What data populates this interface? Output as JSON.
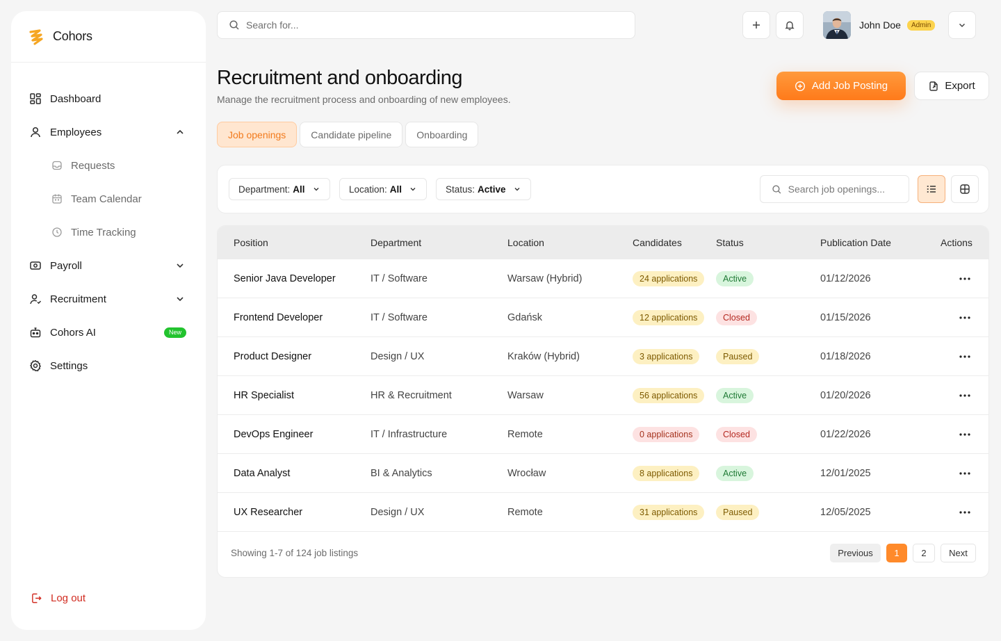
{
  "app": {
    "name": "Cohors"
  },
  "colors": {
    "accent": "#FF8A2A",
    "active_tab_bg": "#FFE6D0",
    "logout": "#D12B20",
    "new_badge": "#22C32E"
  },
  "sidebar": {
    "items": [
      {
        "label": "Dashboard",
        "icon": "dashboard-icon"
      },
      {
        "label": "Employees",
        "icon": "user-icon",
        "expanded": true
      },
      {
        "label": "Requests",
        "icon": "inbox-icon",
        "sub": true
      },
      {
        "label": "Team Calendar",
        "icon": "calendar-icon",
        "sub": true
      },
      {
        "label": "Time Tracking",
        "icon": "clock-icon",
        "sub": true
      },
      {
        "label": "Payroll",
        "icon": "wallet-icon",
        "expanded": false
      },
      {
        "label": "Recruitment",
        "icon": "user-plus-icon",
        "expanded": false
      },
      {
        "label": "Cohors AI",
        "icon": "robot-icon",
        "badge": "New"
      },
      {
        "label": "Settings",
        "icon": "gear-icon"
      }
    ],
    "logout": "Log out"
  },
  "topbar": {
    "search_placeholder": "Search for...",
    "user_name": "John Doe",
    "user_role": "Admin"
  },
  "header": {
    "title": "Recruitment and onboarding",
    "subtitle": "Manage the recruitment process and onboarding of new employees.",
    "add_button": "Add Job Posting",
    "export_button": "Export"
  },
  "tabs": [
    "Job openings",
    "Candidate pipeline",
    "Onboarding"
  ],
  "active_tab": "Job openings",
  "filters": {
    "department": {
      "label": "Department:",
      "value": "All"
    },
    "location": {
      "label": "Location:",
      "value": "All"
    },
    "status": {
      "label": "Status:",
      "value": "Active"
    },
    "search_placeholder": "Search job openings...",
    "view": "list"
  },
  "table": {
    "columns": [
      "Position",
      "Department",
      "Location",
      "Candidates",
      "Status",
      "Publication Date",
      "Actions"
    ],
    "rows": [
      {
        "position": "Senior Java Developer",
        "department": "IT / Software",
        "location": "Warsaw (Hybrid)",
        "candidates": "24 applications",
        "status": "Active",
        "date": "01/12/2026"
      },
      {
        "position": "Frontend Developer",
        "department": "IT / Software",
        "location": "Gdańsk",
        "candidates": "12 applications",
        "status": "Closed",
        "date": "01/15/2026"
      },
      {
        "position": "Product Designer",
        "department": "Design / UX",
        "location": "Kraków (Hybrid)",
        "candidates": "3 applications",
        "status": "Paused",
        "date": "01/18/2026"
      },
      {
        "position": "HR Specialist",
        "department": "HR & Recruitment",
        "location": "Warsaw",
        "candidates": "56 applications",
        "status": "Active",
        "date": "01/20/2026"
      },
      {
        "position": "DevOps Engineer",
        "department": "IT / Infrastructure",
        "location": "Remote",
        "candidates": "0 applications",
        "status": "Closed",
        "date": "01/22/2026"
      },
      {
        "position": "Data Analyst",
        "department": "BI & Analytics",
        "location": "Wrocław",
        "candidates": "8 applications",
        "status": "Active",
        "date": "12/01/2025"
      },
      {
        "position": "UX Researcher",
        "department": "Design / UX",
        "location": "Remote",
        "candidates": "31 applications",
        "status": "Paused",
        "date": "12/05/2025"
      }
    ]
  },
  "pagination": {
    "summary": "Showing 1-7 of 124 job listings",
    "previous": "Previous",
    "pages": [
      "1",
      "2"
    ],
    "current": "1",
    "next": "Next"
  }
}
